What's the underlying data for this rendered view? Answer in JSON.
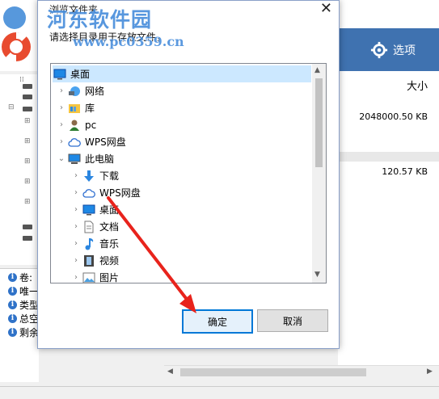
{
  "app": {
    "options_label": "选项",
    "column_size": "大小",
    "sizes": [
      "2048000.50 KB",
      "120.57 KB"
    ],
    "info_labels": [
      "卷:",
      "唯一",
      "类型",
      "总空",
      "剩余"
    ]
  },
  "dialog": {
    "title": "浏览文件夹",
    "description": "请选择目录用于存放文件。",
    "ok_label": "确定",
    "cancel_label": "取消",
    "tree": [
      {
        "label": "桌面",
        "icon": "desktop-icon"
      },
      {
        "label": "网络",
        "icon": "network-icon"
      },
      {
        "label": "库",
        "icon": "library-icon"
      },
      {
        "label": "pc",
        "icon": "user-icon"
      },
      {
        "label": "WPS网盘",
        "icon": "cloud-icon"
      },
      {
        "label": "此电脑",
        "icon": "computer-icon"
      },
      {
        "label": "下载",
        "icon": "download-icon"
      },
      {
        "label": "WPS网盘",
        "icon": "cloud-icon"
      },
      {
        "label": "桌面",
        "icon": "desktop-icon"
      },
      {
        "label": "文档",
        "icon": "document-icon"
      },
      {
        "label": "音乐",
        "icon": "music-icon"
      },
      {
        "label": "视频",
        "icon": "video-icon"
      },
      {
        "label": "图片",
        "icon": "picture-icon"
      }
    ]
  },
  "watermark": {
    "name": "河东软件园",
    "url": "www.pc0359.cn"
  },
  "colors": {
    "selection": "#cce8ff",
    "banner": "#3f72b0",
    "annotation_arrow": "#e8231c",
    "primary_border": "#0078d7"
  }
}
